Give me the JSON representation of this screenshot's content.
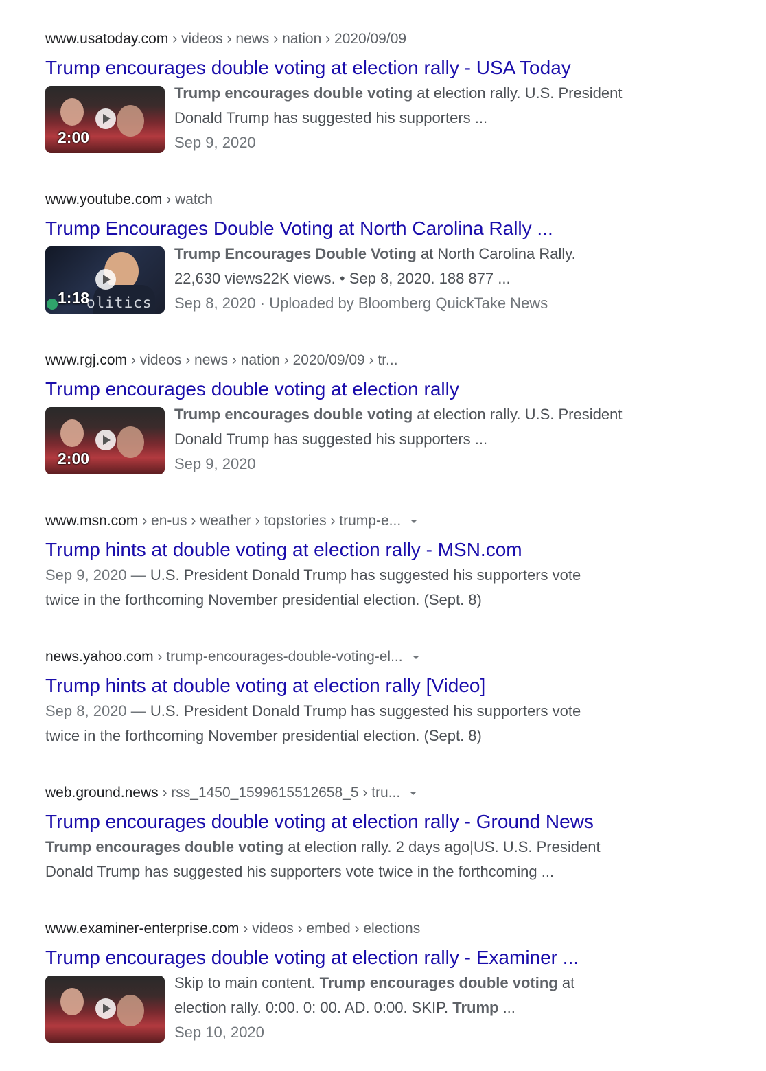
{
  "results": [
    {
      "site": "www.usatoday.com",
      "path": " › videos › news › nation › 2020/09/09",
      "title": "Trump encourages double voting at election rally - USA Today",
      "duration": "2:00",
      "snippet_bold": "Trump encourages double voting",
      "snippet_rest": " at election rally. U.S. President",
      "snippet_line2": "Donald Trump has suggested his supporters ...",
      "date": "Sep 9, 2020"
    },
    {
      "site": "www.youtube.com",
      "path": " › watch",
      "title": "Trump Encourages Double Voting at North Carolina Rally ...",
      "duration": "1:18",
      "thumb_brand": "olitics",
      "snippet_bold": "Trump Encourages Double Voting",
      "snippet_rest": " at North Carolina Rally.",
      "snippet_line2": "22,630 views22K views. • Sep 8, 2020. 188 877 ...",
      "date": "Sep 8, 2020 · Uploaded by Bloomberg QuickTake News"
    },
    {
      "site": "www.rgj.com",
      "path": " › videos › news › nation › 2020/09/09 › tr...",
      "title": "Trump encourages double voting at election rally",
      "duration": "2:00",
      "snippet_bold": "Trump encourages double voting",
      "snippet_rest": " at election rally. U.S. President",
      "snippet_line2": "Donald Trump has suggested his supporters ...",
      "date": "Sep 9, 2020"
    },
    {
      "site": "www.msn.com",
      "path": " › en-us › weather › topstories › trump-e...",
      "title": "Trump hints at double voting at election rally - MSN.com",
      "date_prefix": "Sep 9, 2020 — ",
      "snippet_line1": "U.S. President Donald Trump has suggested his supporters vote",
      "snippet_line2": "twice in the forthcoming November presidential election. (Sept. 8)"
    },
    {
      "site": "news.yahoo.com",
      "path": " › trump-encourages-double-voting-el...",
      "title": "Trump hints at double voting at election rally [Video]",
      "date_prefix": "Sep 8, 2020 — ",
      "snippet_line1": "U.S. President Donald Trump has suggested his supporters vote",
      "snippet_line2": "twice in the forthcoming November presidential election. (Sept. 8)"
    },
    {
      "site": "web.ground.news",
      "path": " › rss_1450_1599615512658_5 › tru...",
      "title": "Trump encourages double voting at election rally - Ground News",
      "snippet_bold": "Trump encourages double voting",
      "snippet_rest": " at election rally. 2 days ago|US. U.S. President",
      "snippet_line2": "Donald Trump has suggested his supporters vote twice in the forthcoming ..."
    },
    {
      "site": "www.examiner-enterprise.com",
      "path": " › videos › embed › elections",
      "title": "Trump encourages double voting at election rally - Examiner ...",
      "snippet_pre": "Skip to main content. ",
      "snippet_bold": "Trump encourages double voting",
      "snippet_rest": " at",
      "snippet_line2_pre": "election rally. 0:00. 0: 00. AD. 0:00. SKIP. ",
      "snippet_line2_bold": "Trump",
      "snippet_line2_post": " ...",
      "date": "Sep 10, 2020"
    }
  ]
}
